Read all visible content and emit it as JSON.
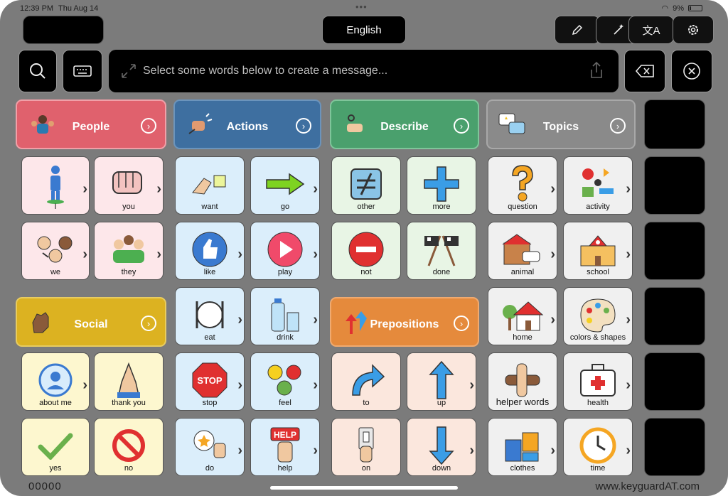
{
  "status": {
    "time": "12:39 PM",
    "date": "Thu Aug 14",
    "battery": "9%"
  },
  "toolbar": {
    "language": "English",
    "message_placeholder": "Select some words below to create a message..."
  },
  "icons": {
    "search": "magnifier",
    "keyboard": "keyboard",
    "pencil": "pencil",
    "wand": "wand",
    "translate": "translate",
    "settings": "gear",
    "backspace": "backspace",
    "clear": "x-circle",
    "share": "share",
    "expand": "expand-arrows"
  },
  "categories": {
    "people": {
      "label": "People",
      "color": "#e0616d"
    },
    "actions": {
      "label": "Actions",
      "color": "#3e6fa0"
    },
    "describe": {
      "label": "Describe",
      "color": "#4aa06d"
    },
    "topics": {
      "label": "Topics",
      "color": "#8a8a8a"
    },
    "social": {
      "label": "Social",
      "color": "#dcb221"
    },
    "prepositions": {
      "label": "Prepositions",
      "color": "#e58a3c"
    }
  },
  "words": {
    "i": "I",
    "you": "you",
    "we": "we",
    "they": "they",
    "about_me": "about me",
    "thank_you": "thank you",
    "yes": "yes",
    "no": "no",
    "want": "want",
    "go": "go",
    "like": "like",
    "play": "play",
    "eat": "eat",
    "drink": "drink",
    "stop": "stop",
    "feel": "feel",
    "do": "do",
    "help": "help",
    "other": "other",
    "more": "more",
    "not": "not",
    "done": "done",
    "to": "to",
    "up": "up",
    "on": "on",
    "down": "down",
    "question": "question",
    "activity": "activity",
    "animal": "animal",
    "school": "school",
    "home": "home",
    "colors_shapes": "colors & shapes",
    "helper_words": "helper words",
    "health": "health",
    "clothes": "clothes",
    "time": "time"
  },
  "footer": {
    "counter": "00000",
    "brand": "www.keyguardAT.com"
  }
}
